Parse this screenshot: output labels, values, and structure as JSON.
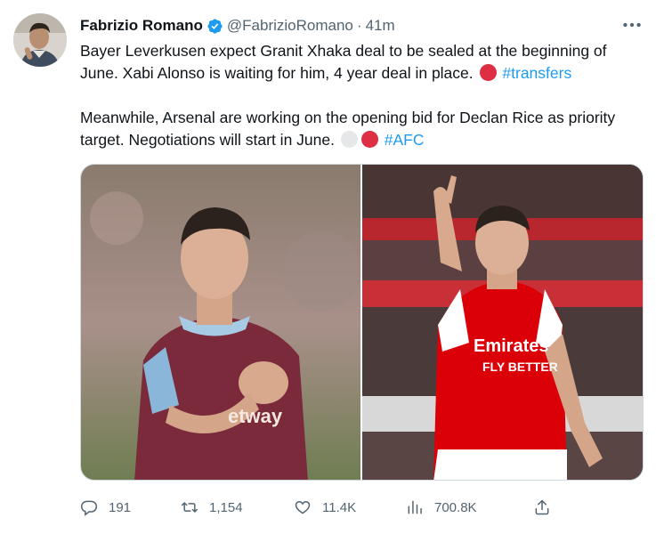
{
  "author": {
    "display_name": "Fabrizio Romano",
    "handle": "@FabrizioRomano",
    "separator": "·",
    "time": "41m",
    "verified_icon": "verified-badge-icon",
    "avatar_icon": "avatar"
  },
  "tweet": {
    "para1_text": "Bayer Leverkusen expect Granit Xhaka deal to be sealed at the beginning of June. Xabi Alonso is waiting for him, 4 year deal in place.",
    "para1_hashtag": "#transfers",
    "para2_text": "Meanwhile, Arsenal are working on the opening bid for Declan Rice as priority target. Negotiations will start in June.",
    "para2_hashtag": "#AFC",
    "emoji_red_circle": "red-circle-icon",
    "emoji_white_circle": "white-circle-icon"
  },
  "media": {
    "left_image": "photo of player in claret and blue kit",
    "right_image": "photo of player in red and white kit"
  },
  "actions": {
    "replies": "191",
    "retweets": "1,154",
    "likes": "11.4K",
    "views": "700.8K"
  },
  "colors": {
    "text": "#0f1419",
    "secondary": "#536471",
    "link": "#1d9bf0",
    "emoji_red": "#dd2e44",
    "emoji_white": "#e6e7e8"
  }
}
